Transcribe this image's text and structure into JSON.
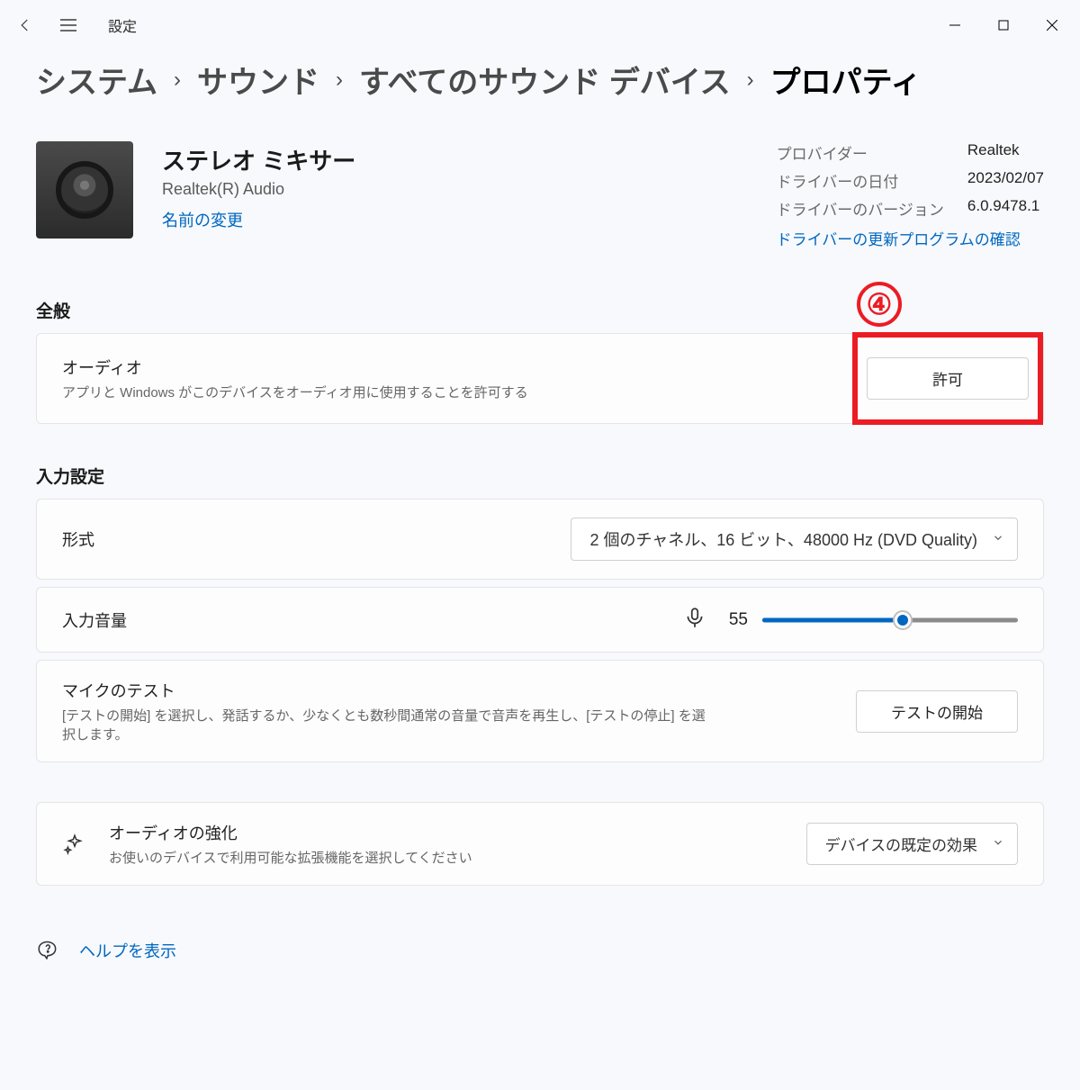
{
  "window": {
    "title": "設定"
  },
  "breadcrumb": {
    "system": "システム",
    "sound": "サウンド",
    "all_devices": "すべてのサウンド デバイス",
    "properties": "プロパティ"
  },
  "device": {
    "name": "ステレオ ミキサー",
    "subtitle": "Realtek(R) Audio",
    "rename_link": "名前の変更"
  },
  "driver": {
    "provider_label": "プロバイダー",
    "provider_value": "Realtek",
    "date_label": "ドライバーの日付",
    "date_value": "2023/02/07",
    "version_label": "ドライバーのバージョン",
    "version_value": "6.0.9478.1",
    "update_link": "ドライバーの更新プログラムの確認"
  },
  "annotation": {
    "step": "④"
  },
  "sections": {
    "general": "全般",
    "input_settings": "入力設定"
  },
  "audio_card": {
    "title": "オーディオ",
    "desc": "アプリと Windows がこのデバイスをオーディオ用に使用することを許可する",
    "button": "許可"
  },
  "format_card": {
    "title": "形式",
    "selected": "2 個のチャネル、16 ビット、48000 Hz (DVD Quality)"
  },
  "volume_card": {
    "title": "入力音量",
    "value": "55",
    "percent": 55
  },
  "mic_test_card": {
    "title": "マイクのテスト",
    "desc": "[テストの開始] を選択し、発話するか、少なくとも数秒間通常の音量で音声を再生し、[テストの停止] を選択します。",
    "button": "テストの開始"
  },
  "enhance_card": {
    "title": "オーディオの強化",
    "desc": "お使いのデバイスで利用可能な拡張機能を選択してください",
    "selected": "デバイスの既定の効果"
  },
  "help": {
    "text": "ヘルプを表示"
  }
}
